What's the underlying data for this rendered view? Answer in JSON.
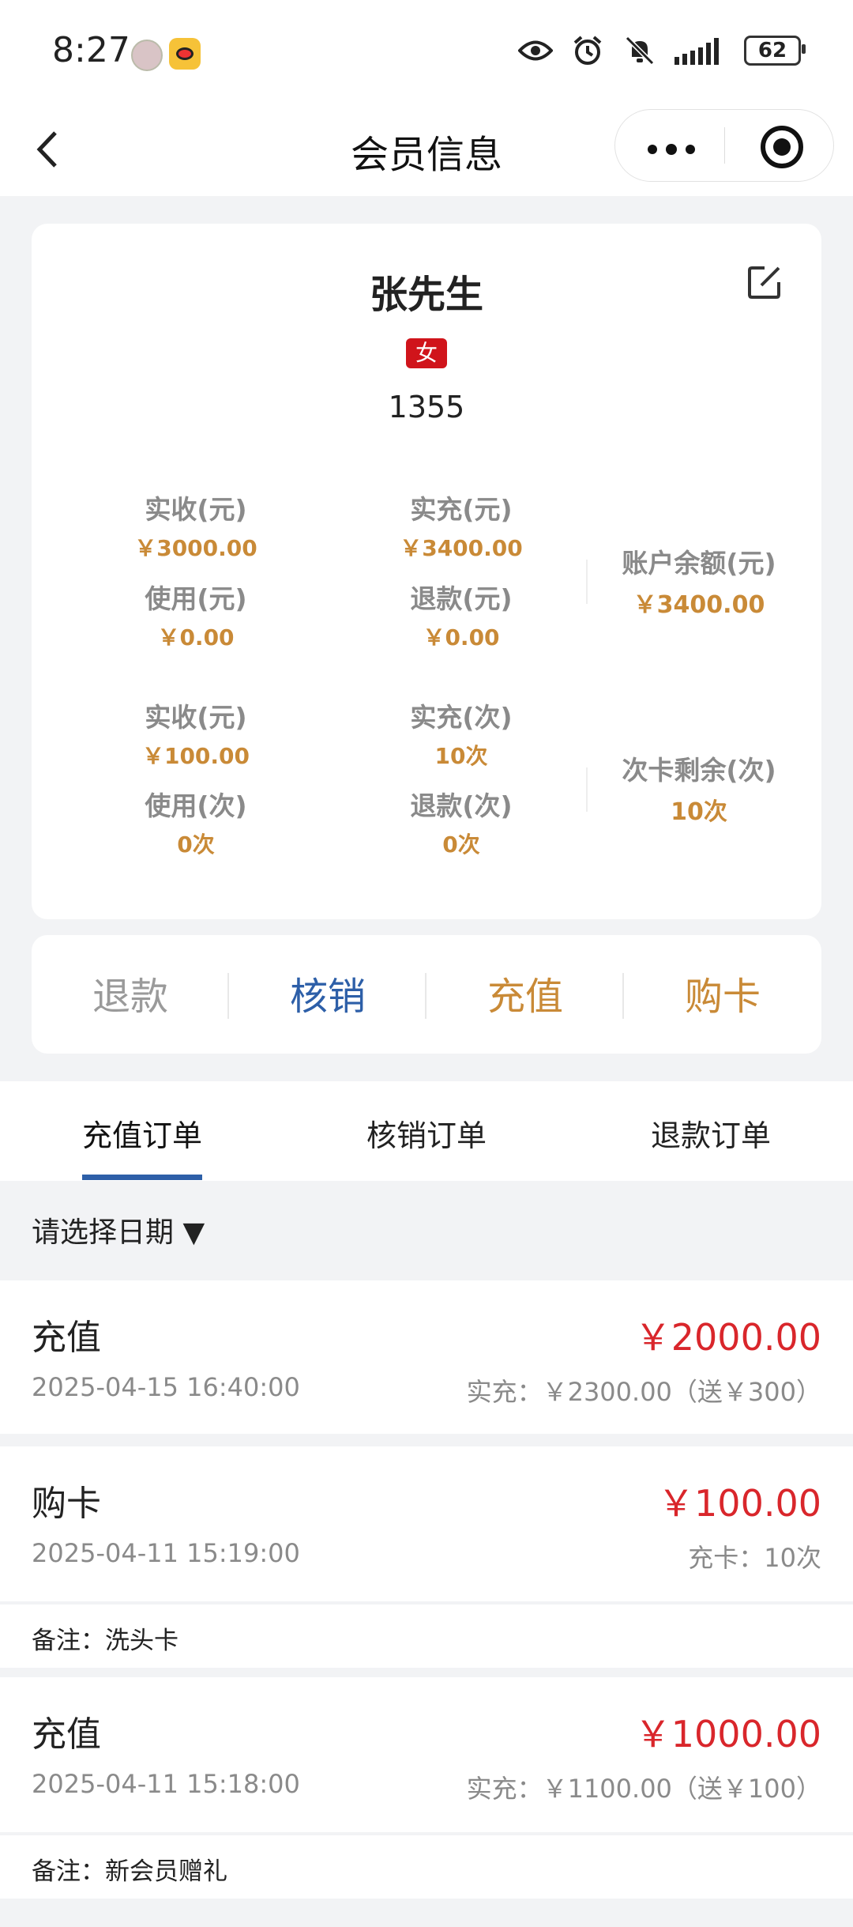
{
  "status_bar": {
    "time": "8:27",
    "battery": "62",
    "icons": [
      "eye-icon",
      "alarm-icon",
      "mute-icon",
      "signal-icon"
    ]
  },
  "nav": {
    "title": "会员信息",
    "back_icon": "chevron-left-icon",
    "more_icon": "more-dots-icon",
    "close_icon": "target-icon"
  },
  "member": {
    "name": "张先生",
    "gender": "女",
    "phone": "1355",
    "balance_stats": {
      "received_label": "实收(元)",
      "received_value": "￥3000.00",
      "charged_label": "实充(元)",
      "charged_value": "￥3400.00",
      "used_label": "使用(元)",
      "used_value": "￥0.00",
      "refund_label": "退款(元)",
      "refund_value": "￥0.00",
      "balance_label": "账户余额(元)",
      "balance_value": "￥3400.00"
    },
    "card_stats": {
      "received_label": "实收(元)",
      "received_value": "￥100.00",
      "charged_label": "实充(次)",
      "charged_value": "10次",
      "used_label": "使用(次)",
      "used_value": "0次",
      "refund_label": "退款(次)",
      "refund_value": "0次",
      "remaining_label": "次卡剩余(次)",
      "remaining_value": "10次"
    }
  },
  "actions": [
    {
      "label": "退款",
      "color": "#9a9a9a"
    },
    {
      "label": "核销",
      "color": "#2d5fa8"
    },
    {
      "label": "充值",
      "color": "#c98a37"
    },
    {
      "label": "购卡",
      "color": "#c98a37"
    }
  ],
  "tabs": [
    "充值订单",
    "核销订单",
    "退款订单"
  ],
  "active_tab": "充值订单",
  "date_filter": "请选择日期 ▼",
  "orders": [
    {
      "type": "充值",
      "amount": "￥2000.00",
      "date": "2025-04-15 16:40:00",
      "detail": "实充：￥2300.00（送￥300）",
      "note": ""
    },
    {
      "type": "购卡",
      "amount": "￥100.00",
      "date": "2025-04-11 15:19:00",
      "detail": "充卡：10次",
      "note": "备注：洗头卡"
    },
    {
      "type": "充值",
      "amount": "￥1000.00",
      "date": "2025-04-11 15:18:00",
      "detail": "实充：￥1100.00（送￥100）",
      "note": "备注：新会员赠礼"
    }
  ]
}
